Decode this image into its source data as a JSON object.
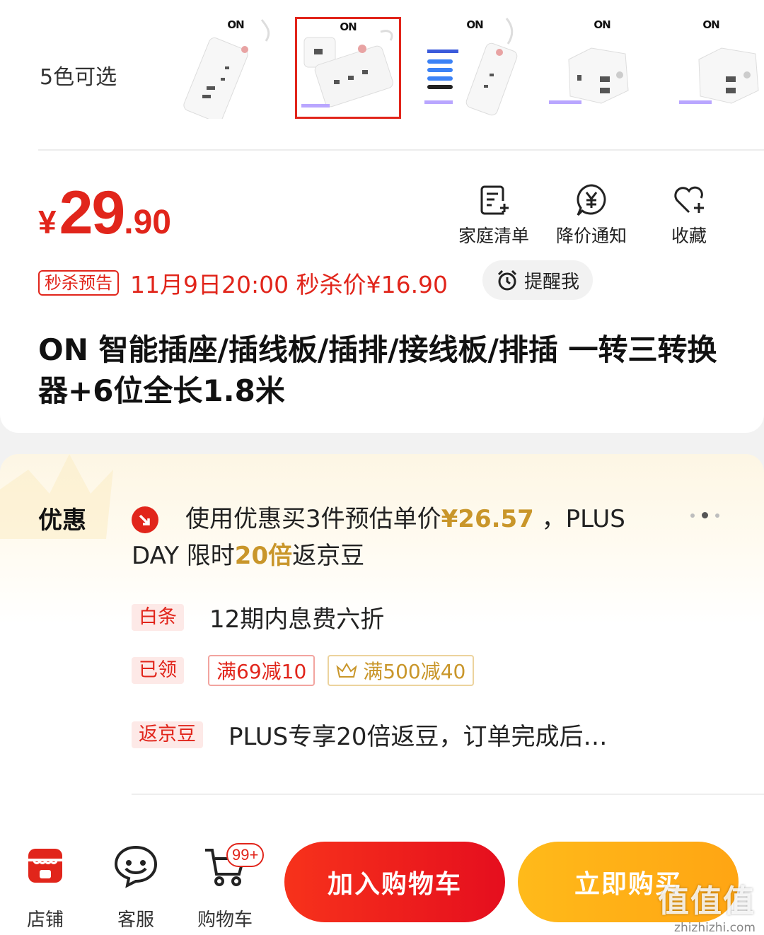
{
  "variants": {
    "label": "5色可选",
    "thumbs": [
      {
        "brand": "ON",
        "selected": false
      },
      {
        "brand": "ON",
        "selected": true
      },
      {
        "brand": "ON",
        "selected": false
      },
      {
        "brand": "ON",
        "selected": false
      },
      {
        "brand": "ON",
        "selected": false
      }
    ]
  },
  "price": {
    "currency": "¥",
    "integer": "29",
    "decimal": ".90"
  },
  "actions": {
    "family_list": "家庭清单",
    "price_alert": "降价通知",
    "favorite": "收藏"
  },
  "seckill": {
    "tag": "秒杀预告",
    "text": "11月9日20:00 秒杀价¥16.90",
    "remind": "提醒我"
  },
  "title": "ON  智能插座/插线板/插排/接线板/排插 一转三转换器+6位全长1.8米",
  "promo": {
    "heading": "优惠",
    "line1_a": "使用优惠买3件预估单价",
    "line1_price": "¥26.57",
    "line1_b": " ，PLUS DAY 限时",
    "line1_mult": "20倍",
    "line1_c": "返京豆",
    "baitiao_badge": "白条",
    "baitiao_text": "12期内息费六折",
    "claimed_badge": "已领",
    "coupon1": "满69减10",
    "coupon2": "满500减40",
    "jingdou_badge": "返京豆",
    "jingdou_text": "PLUS专享20倍返豆，订单完成后…"
  },
  "bottom": {
    "store": "店铺",
    "service": "客服",
    "cart": "购物车",
    "cart_count": "99+",
    "add_to_cart": "加入购物车",
    "buy_now": "立即购买"
  },
  "watermark": {
    "big": "值值值",
    "small": "zhizhizhi.com"
  },
  "colors": {
    "accent": "#e1251b",
    "gold": "#c9962a",
    "buy": "#ffb017"
  }
}
